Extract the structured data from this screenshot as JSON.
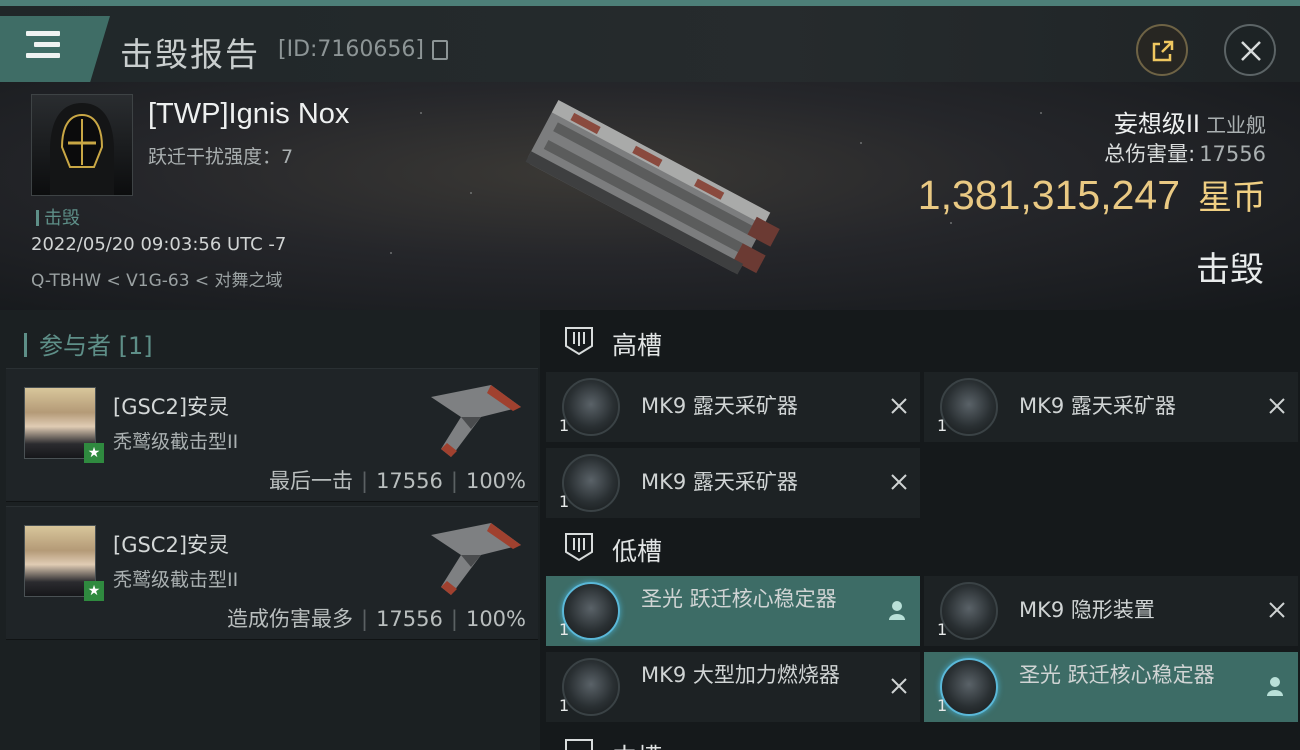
{
  "header": {
    "title": "击毁报告",
    "report_id": "[ID:7160656]"
  },
  "victim": {
    "name": "[TWP]Ignis Nox",
    "warp_scramble": "跃迁干扰强度：7",
    "tag": "击毁",
    "timestamp": "2022/05/20 09:03:56 UTC -7",
    "location": "Q-TBHW < V1G-63 < 对舞之域",
    "ship_class": "妄想级II",
    "ship_category": "工业舰",
    "total_damage_label": "总伤害量:",
    "total_damage": "17556",
    "isk_value": "1,381,315,247",
    "isk_unit": "星币",
    "status": "击毁"
  },
  "participants": {
    "title": "参与者 [1]",
    "cards": [
      {
        "name": "[GSC2]安灵",
        "ship": "秃鹫级截击型II",
        "role": "最后一击",
        "damage": "17556",
        "percent": "100%"
      },
      {
        "name": "[GSC2]安灵",
        "ship": "秃鹫级截击型II",
        "role": "造成伤害最多",
        "damage": "17556",
        "percent": "100%"
      }
    ]
  },
  "fitting": {
    "high_label": "高槽",
    "low_label": "低槽",
    "mid_label": "中槽",
    "high": [
      {
        "name": "MK9 露天采矿器",
        "qty": "1",
        "status": "destroyed"
      },
      {
        "name": "MK9 露天采矿器",
        "qty": "1",
        "status": "destroyed"
      },
      {
        "name": "MK9 露天采矿器",
        "qty": "1",
        "status": "destroyed"
      }
    ],
    "low": [
      {
        "name": "圣光 跃迁核心稳定器",
        "qty": "1",
        "status": "dropped"
      },
      {
        "name": "MK9 隐形装置",
        "qty": "1",
        "status": "destroyed"
      },
      {
        "name": "MK9 大型加力燃烧器",
        "qty": "1",
        "status": "destroyed"
      },
      {
        "name": "圣光 跃迁核心稳定器",
        "qty": "1",
        "status": "dropped"
      }
    ]
  },
  "colors": {
    "accent_teal": "#3d6c66",
    "isk_gold": "#e9c983"
  }
}
